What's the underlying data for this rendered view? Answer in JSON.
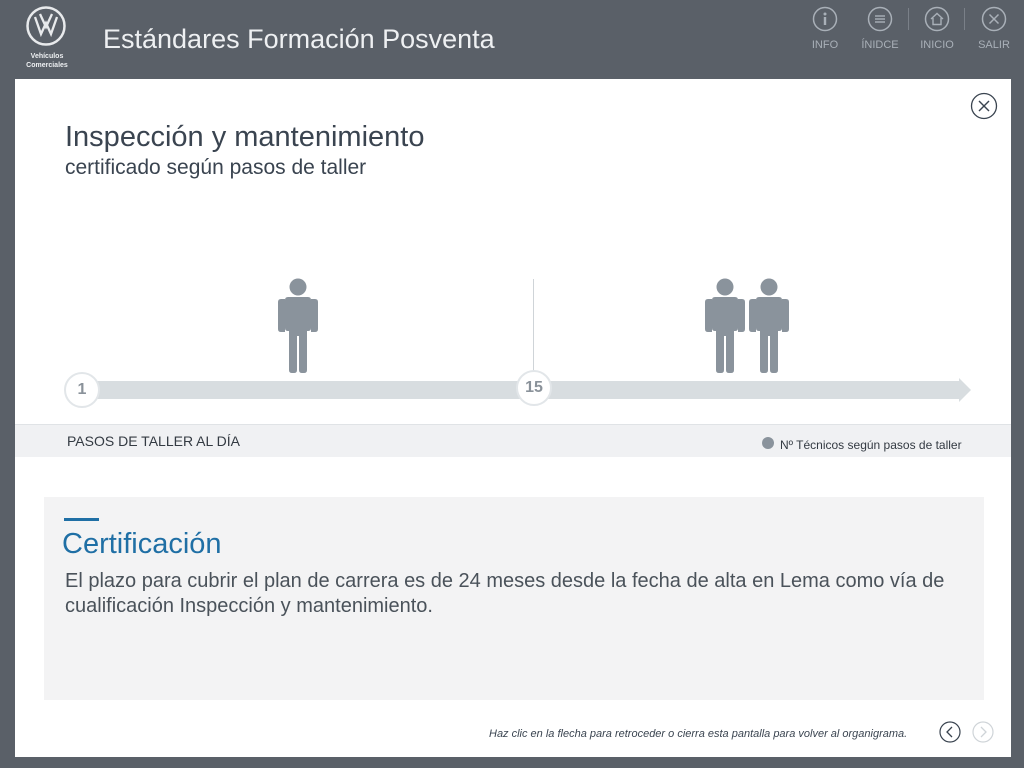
{
  "header": {
    "title": "Estándares Formación Posventa",
    "brand_line1": "Vehículos",
    "brand_line2": "Comerciales",
    "nav": [
      {
        "label": "INFO",
        "icon": "info-icon"
      },
      {
        "label": "ÍNIDCE",
        "icon": "list-icon"
      },
      {
        "label": "INICIO",
        "icon": "home-icon"
      },
      {
        "label": "SALIR",
        "icon": "close-icon"
      }
    ]
  },
  "modal": {
    "title": "Inspección y mantenimiento",
    "subtitle": "certificado según pasos de taller",
    "timeline": {
      "markers": [
        "1",
        "15"
      ],
      "technicians_left": 1,
      "technicians_right": 2,
      "axis_label": "PASOS DE TALLER AL DÍA",
      "legend_label": "Nº Técnicos según pasos de taller"
    },
    "certification": {
      "heading": "Certificación",
      "body": "El plazo para cubrir el plan de carrera es de 24 meses desde la fecha de alta en Lema como vía de cualificación Inspección y mantenimiento."
    },
    "hint": "Haz clic en la flecha para retroceder o cierra esta pantalla para volver al organigrama."
  },
  "colors": {
    "background": "#5a6068",
    "accent": "#1f6fa5",
    "figure": "#8a939c",
    "bar": "#d8dde0"
  }
}
